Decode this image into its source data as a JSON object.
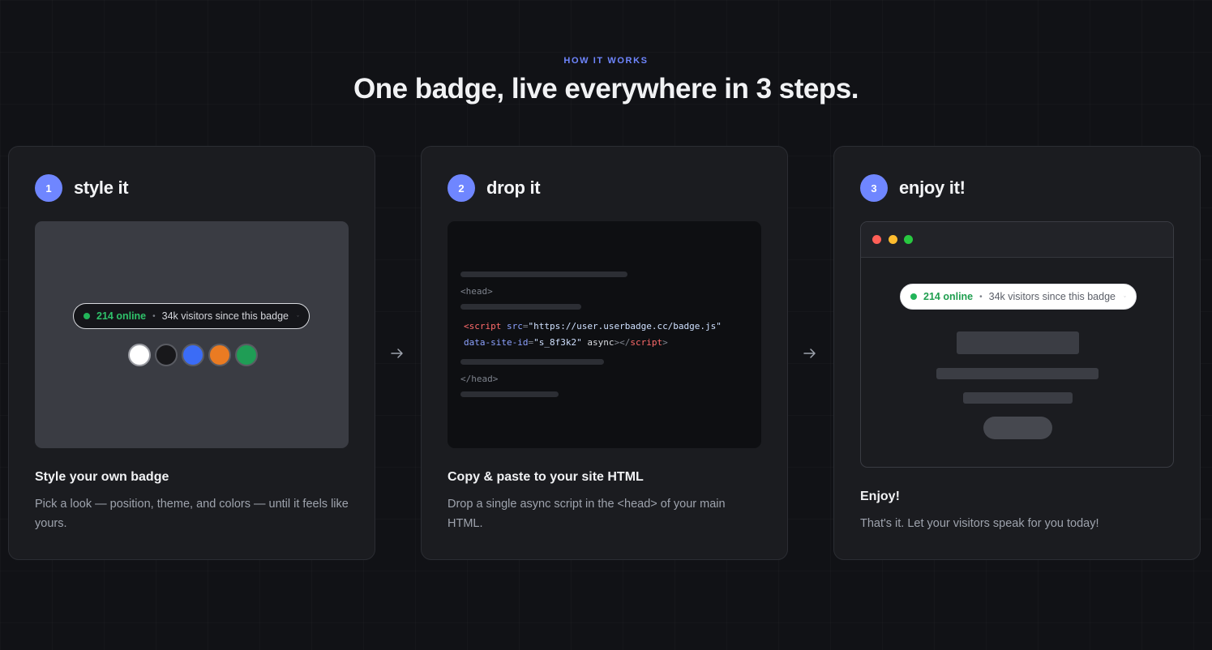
{
  "section": {
    "eyebrow": "HOW IT WORKS",
    "headline": "One badge, live everywhere in 3 steps."
  },
  "badge": {
    "online": "214 online",
    "separator": "•",
    "visitors": "34k visitors since this badge"
  },
  "steps": [
    {
      "number": "1",
      "title": "style it",
      "card_title": "Style your own badge",
      "description": "Pick a look — position, theme, and colors — until it feels like yours.",
      "swatches": [
        "#ffffff",
        "#18181b",
        "#3b6cf6",
        "#ea7b22",
        "#1f9d55"
      ]
    },
    {
      "number": "2",
      "title": "drop it",
      "card_title": "Copy & paste to your site HTML",
      "description": "Drop a single async script in the <head> of your main HTML.",
      "code": {
        "head_open": "<head>",
        "lt": "<",
        "script_tag": "script",
        "src_attr": "src",
        "eq": "=",
        "src_value": "\"https://user.userbadge.cc/badge.js\"",
        "site_attr": "data-site-id",
        "site_value": "\"s_8f3k2\"",
        "async": "async",
        "close_lt": "></",
        "close_script": "script",
        "gt": ">",
        "head_close": "</head>"
      }
    },
    {
      "number": "3",
      "title": "enjoy it!",
      "card_title": "Enjoy!",
      "description": "That's it. Let your visitors speak for you today!",
      "traffic_lights": [
        "#ff5f57",
        "#febc2e",
        "#28c840"
      ]
    }
  ],
  "colors": {
    "accent": "#6f86ff",
    "background": "#111216",
    "card": "#1b1c20"
  }
}
